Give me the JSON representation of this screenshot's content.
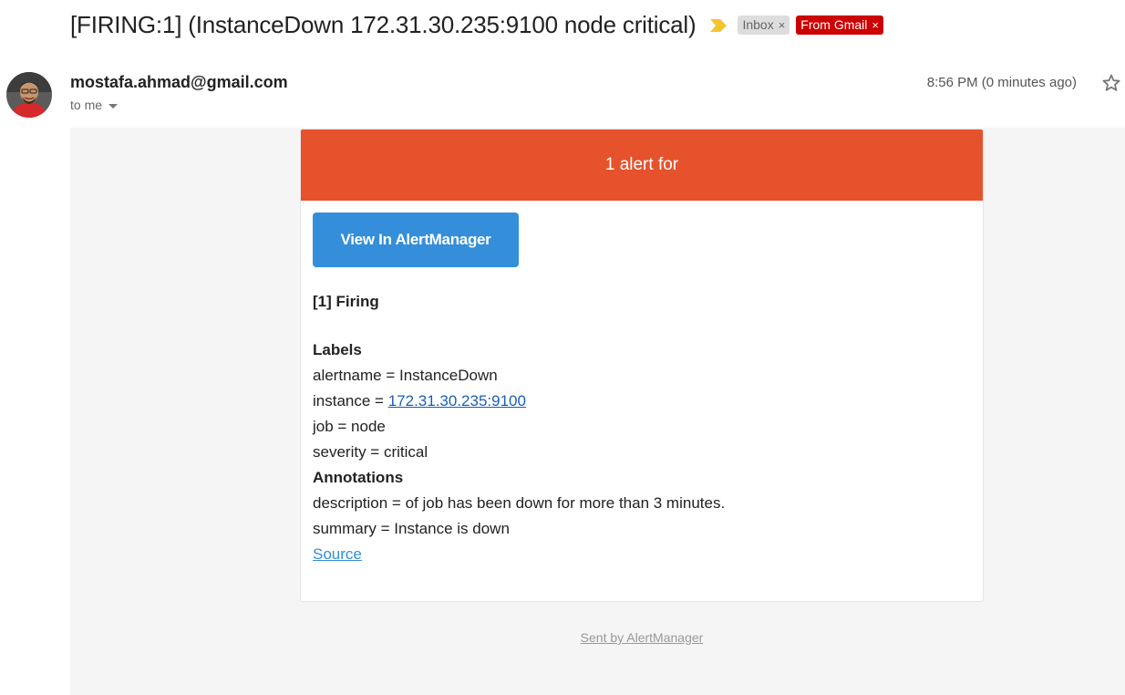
{
  "header": {
    "subject": "[FIRING:1] (InstanceDown 172.31.30.235:9100 node critical)",
    "importance_icon": "importance-marker-icon",
    "labels": [
      {
        "text": "Inbox",
        "close": "×"
      },
      {
        "text": "From Gmail",
        "close": "×"
      }
    ]
  },
  "message": {
    "avatar_icon": "sender-avatar",
    "sender": "mostafa.ahmad@gmail.com",
    "recipient": "to me",
    "date": "8:56 PM (0 minutes ago)",
    "star_icon": "star-icon"
  },
  "alert": {
    "banner": "1 alert for",
    "button_label": "View In AlertManager",
    "firing_title": "[1] Firing",
    "labels_heading": "Labels",
    "alertname": "alertname = InstanceDown",
    "instance_prefix": "instance = ",
    "instance_link": "172.31.30.235:9100",
    "job": "job = node",
    "severity": "severity = critical",
    "annotations_heading": "Annotations",
    "description": "description = of job has been down for more than 3 minutes.",
    "summary": "summary = Instance is down",
    "source_link": "Source",
    "footer": "Sent by AlertManager"
  },
  "colors": {
    "banner": "#e6522c",
    "button": "#348eda",
    "gmail_label": "#cc0000",
    "importance": "#f4c430"
  }
}
